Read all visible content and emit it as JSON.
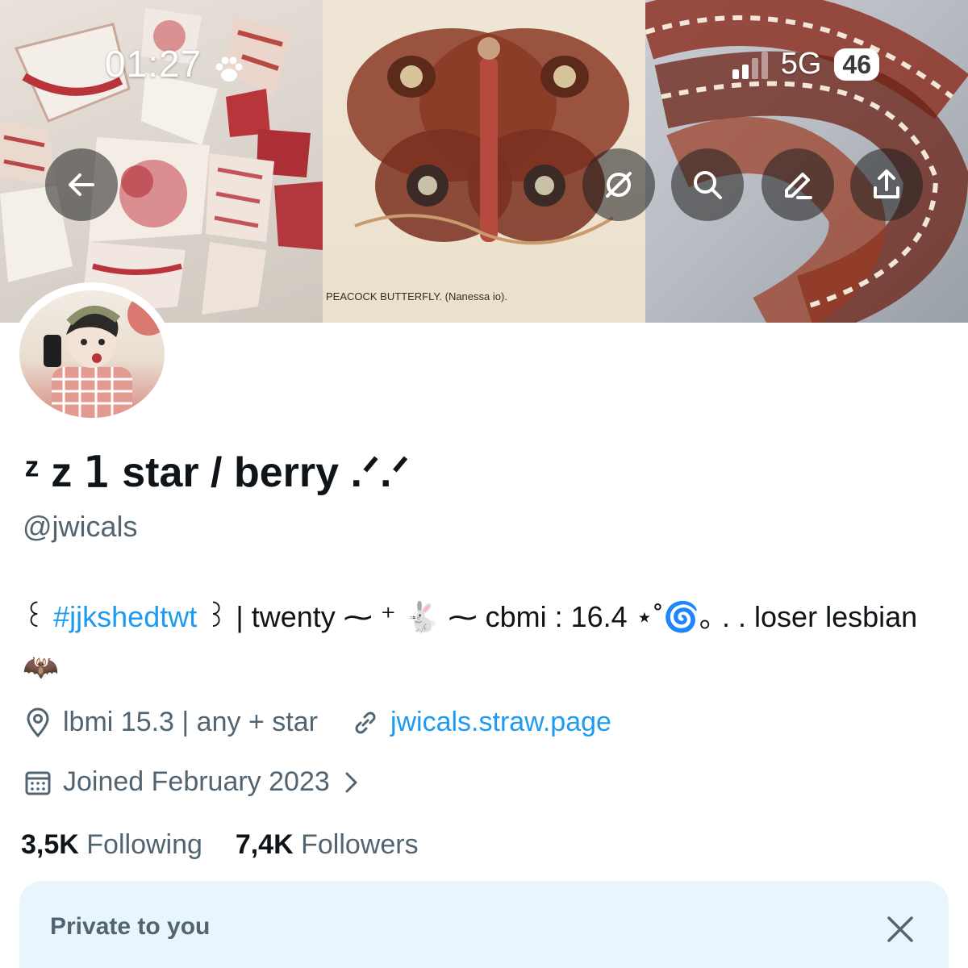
{
  "status_bar": {
    "time": "01:27",
    "time_icon": "paw-icon",
    "network": "5G",
    "battery": "46"
  },
  "banner": {
    "caption": "PEACOCK BUTTERFLY. (Nanessa io)."
  },
  "toolbar": {
    "back_icon": "back-arrow-icon",
    "grok_icon": "grok-icon",
    "search_icon": "search-icon",
    "edit_icon": "edit-icon",
    "share_icon": "share-icon"
  },
  "profile": {
    "display_name": "ᶻ z 𝟣 star / berry .ᐟ.ᐟ",
    "handle": "@jwicals",
    "bio_prefix": "꒰ ",
    "bio_hashtag": "#jjkshedtwt",
    "bio_rest": " ꒱ | twenty ⁓ ⁺ 🐇 ⁓ cbmi : 16.4 ⋆˚🌀｡ . . loser lesbian 🦇",
    "location": "lbmi 15.3 | any + star",
    "website": "jwicals.straw.page",
    "joined": "Joined February 2023",
    "following_count": "3,5K",
    "following_label": "Following",
    "followers_count": "7,4K",
    "followers_label": "Followers"
  },
  "private_card": {
    "label": "Private to you"
  },
  "colors": {
    "link": "#1d9bf0",
    "secondary_text": "#536471",
    "card_bg": "#e8f5fd"
  }
}
